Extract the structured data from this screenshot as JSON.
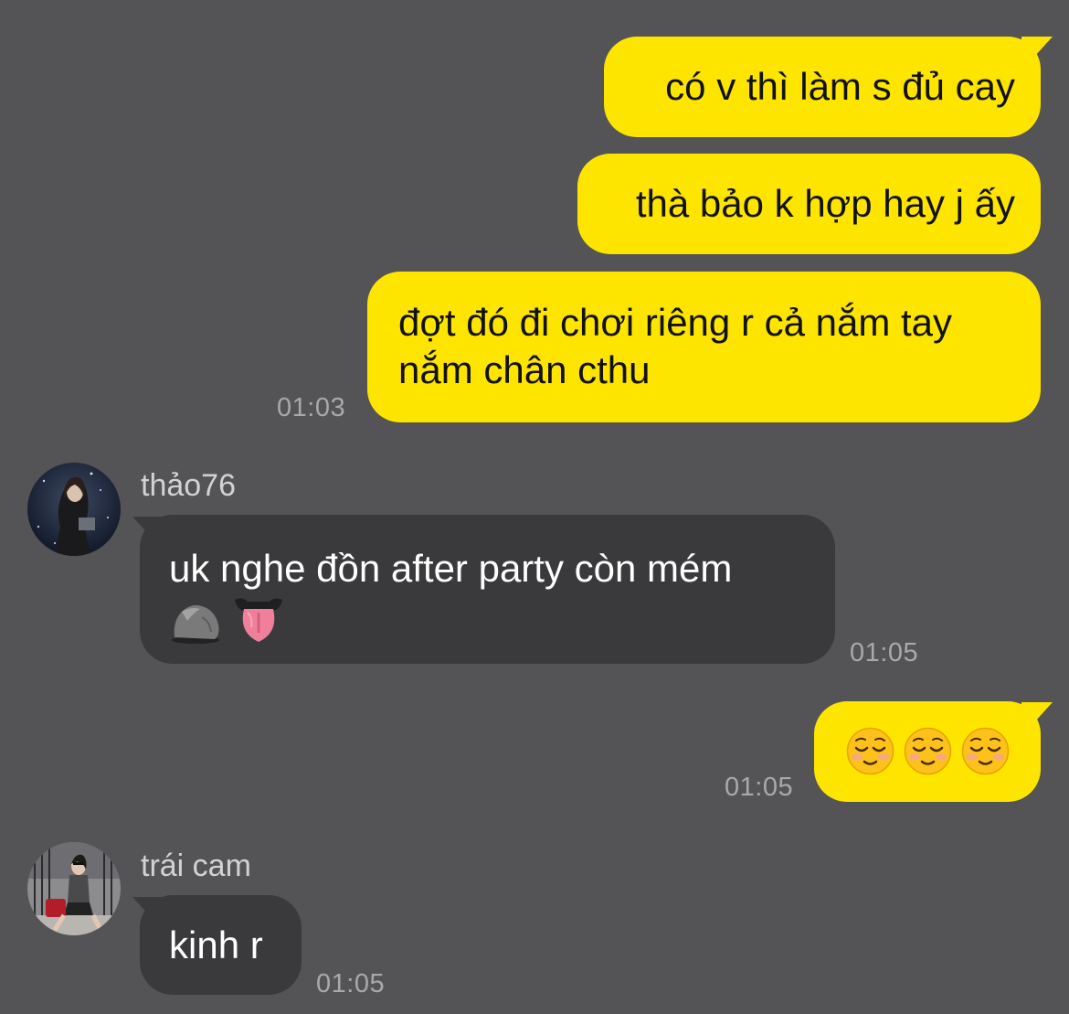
{
  "messages": [
    {
      "id": "m1",
      "direction": "outgoing",
      "text": "có v thì làm s đủ cay"
    },
    {
      "id": "m2",
      "direction": "outgoing",
      "text": "thà bảo k hợp hay j ấy"
    },
    {
      "id": "m3",
      "direction": "outgoing",
      "line1": "đợt đó đi chơi riêng r cả nắm tay",
      "line2": "nắm chân cthu",
      "time": "01:03"
    },
    {
      "id": "m4",
      "direction": "incoming",
      "sender": "thảo76",
      "line1": "uk nghe đồn after party còn mém",
      "emojis": [
        "rock-emoji",
        "tongue-emoji"
      ],
      "time": "01:05"
    },
    {
      "id": "m5",
      "direction": "outgoing",
      "emojis": [
        "smiling-face-emoji",
        "smiling-face-emoji",
        "smiling-face-emoji"
      ],
      "time": "01:05"
    },
    {
      "id": "m6",
      "direction": "incoming",
      "sender": "trái cam",
      "text": "kinh r",
      "time": "01:05"
    }
  ],
  "colors": {
    "background": "#545355",
    "outgoing_bubble": "#fee500",
    "incoming_bubble": "#3a393b",
    "timestamp": "#a9a8aa",
    "sender_name": "#d2d1d3"
  }
}
